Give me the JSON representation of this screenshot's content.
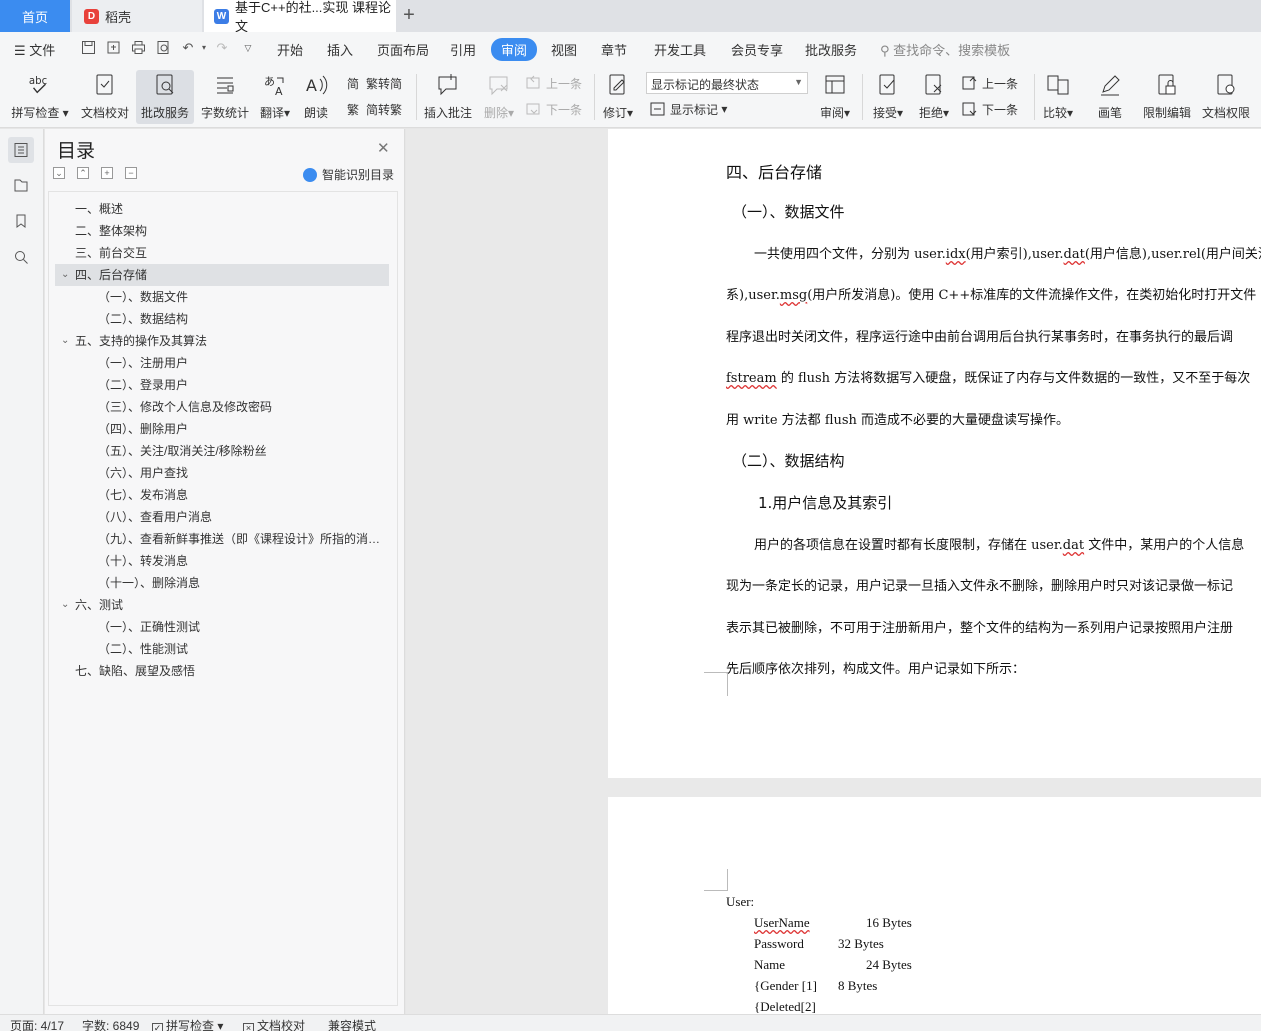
{
  "tabs": {
    "home": "首页",
    "daoke": "稻壳",
    "doc": "基于C++的社...实现 课程论文",
    "add": "+"
  },
  "menu": {
    "file": "文件",
    "items": [
      "开始",
      "插入",
      "页面布局",
      "引用",
      "审阅",
      "视图",
      "章节",
      "开发工具",
      "会员专享",
      "批改服务"
    ],
    "active": "审阅",
    "search": "查找命令、搜索模板"
  },
  "ribbon": {
    "spell": "拼写检查",
    "proofread": "文档校对",
    "grading": "批改服务",
    "wordcount": "字数统计",
    "translate": "翻译",
    "read": "朗读",
    "trad": "繁转简",
    "simp": "简转繁",
    "insert_comment": "插入批注",
    "delete": "删除",
    "prev": "上一条",
    "next": "下一条",
    "track": "修订",
    "markup_state": "显示标记的最终状态",
    "show_markup": "显示标记",
    "review": "审阅",
    "accept": "接受",
    "reject": "拒绝",
    "prev2": "上一条",
    "next2": "下一条",
    "compare": "比较",
    "pen": "画笔",
    "restrict": "限制编辑",
    "doc_perm": "文档权限"
  },
  "toc": {
    "title": "目录",
    "smart": "智能识别目录",
    "items": [
      "一、概述",
      "二、整体架构",
      "三、前台交互",
      "四、后台存储",
      "（一）、数据文件",
      "（二）、数据结构",
      "五、支持的操作及其算法",
      "（一）、注册用户",
      "（二）、登录用户",
      "（三）、修改个人信息及修改密码",
      "（四）、删除用户",
      "（五）、关注/取消关注/移除粉丝",
      "（六）、用户查找",
      "（七）、发布消息",
      "（八）、查看用户消息",
      "（九）、查看新鲜事推送（即《课程设计》所指的消息动态）",
      "（十）、转发消息",
      "（十一）、删除消息",
      "六、测试",
      "（一）、正确性测试",
      "（二）、性能测试",
      "七、缺陷、展望及感悟"
    ],
    "selected_index": 3
  },
  "doc": {
    "h_storage": "四、后台存储",
    "h_datafile": "（一）、数据文件",
    "p1_l1_a": "一共使用四个文件，分别为 user.",
    "p1_l1_idx": "idx",
    "p1_l1_b": "(用户索引),user.",
    "p1_l1_dat": "dat",
    "p1_l1_c": "(用户信息),user.rel(用户间关注",
    "p1_l2_a": "系),user.",
    "p1_l2_msg": "msg",
    "p1_l2_b": "(用户所发消息)。使用 C++标准库的文件流操作文件，在类初始化时打开文件",
    "p1_l3": "程序退出时关闭文件，程序运行途中由前台调用后台执行某事务时，在事务执行的最后调",
    "p1_l4_fs": "fstream",
    "p1_l4_b": " 的 flush 方法将数据写入硬盘，既保证了内存与文件数据的一致性，又不至于每次",
    "p1_l5": "用 write 方法都 flush 而造成不必要的大量硬盘读写操作。",
    "h_datastruct": "（二）、数据结构",
    "h_userinfo": "1.用户信息及其索引",
    "p2_l1_a": "用户的各项信息在设置时都有长度限制，存储在 user.",
    "p2_l1_dat": "dat",
    "p2_l1_b": " 文件中，某用户的个人信息",
    "p2_l2": "现为一条定长的记录，用户记录一旦插入文件永不删除，删除用户时只对该记录做一标记",
    "p2_l3": "表示其已被删除，不可用于注册新用户，整个文件的结构为一系列用户记录按照用户注册",
    "p2_l4": "先后顺序依次排列，构成文件。用户记录如下所示：",
    "code_user": "User:",
    "code_username": "UserName",
    "code_username_size": "16 Bytes",
    "code_password": "Password",
    "code_password_size": "32 Bytes",
    "code_name": "Name",
    "code_name_size": "24 Bytes",
    "code_gender": "{Gender [1]",
    "code_gender_size": "8    Bytes",
    "code_deleted": "{Deleted[2]"
  },
  "status": {
    "page": "页面: 4/17",
    "words": "字数: 6849",
    "spell": "拼写检查",
    "proof": "文档校对",
    "compat": "兼容模式"
  },
  "colors": {
    "accent": "#3b8cf0",
    "spell_underline": "#d33"
  }
}
